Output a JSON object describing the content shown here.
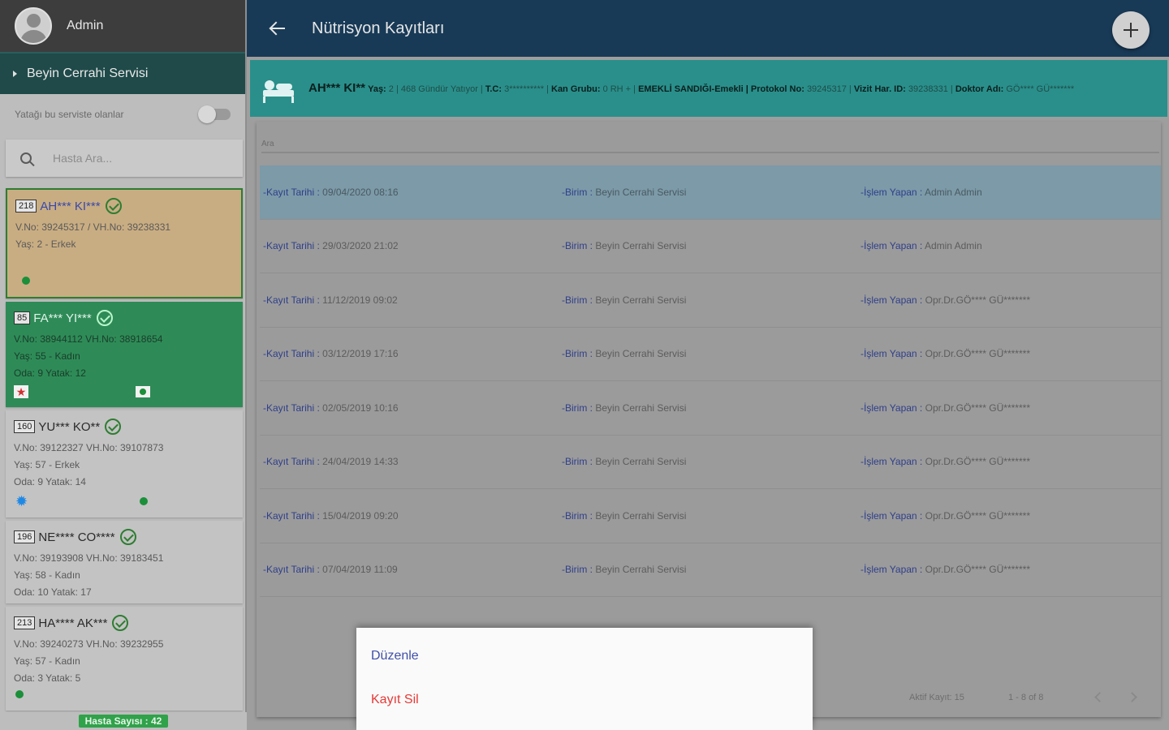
{
  "sidebar": {
    "user_name": "Admin",
    "service_name": "Beyin Cerrahi Servisi",
    "toggle_label": "Yatağı bu serviste olanlar",
    "search_placeholder": "Hasta Ara...",
    "patient_count": "Hasta Sayısı : 42",
    "patients": [
      {
        "bed": "218",
        "name": "AH*** KI***",
        "line1": "V.No: 39245317 / VH.No: 39238331",
        "line2": "Yaş: 2 - Erkek",
        "line3": ""
      },
      {
        "bed": "85",
        "name": "FA*** YI***",
        "line1": "V.No: 38944112 VH.No: 38918654",
        "line2": "Yaş: 55 - Kadın",
        "line3": "Oda: 9 Yatak: 12"
      },
      {
        "bed": "160",
        "name": "YU*** KO**",
        "line1": "V.No: 39122327 VH.No: 39107873",
        "line2": "Yaş: 57 - Erkek",
        "line3": "Oda: 9 Yatak: 14"
      },
      {
        "bed": "196",
        "name": "NE**** CO****",
        "line1": "V.No: 39193908 VH.No: 39183451",
        "line2": "Yaş: 58 - Kadın",
        "line3": "Oda: 10 Yatak: 17"
      },
      {
        "bed": "213",
        "name": "HA**** AK***",
        "line1": "V.No: 39240273 VH.No: 39232955",
        "line2": "Yaş: 57 - Kadın",
        "line3": "Oda: 3 Yatak: 5"
      }
    ]
  },
  "header": {
    "title": "Nütrisyon Kayıtları"
  },
  "banner": {
    "name": "AH*** KI**",
    "age_label": "Yaş:",
    "age_value": "2 | 468 Gündür Yatıyor |",
    "tc_label": "T.C:",
    "tc_value": "3********** |",
    "blood_label": "Kan Grubu:",
    "blood_value": "0 RH + |",
    "insurance": "EMEKLİ SANDIĞI-Emekli |",
    "protocol_label": "Protokol No:",
    "protocol_value": "39245317 |",
    "visit_label": "Vizit Har. ID:",
    "visit_value": "39238331 |",
    "doctor_label": "Doktor Adı:",
    "doctor_value": "GÖ**** GÜ*******"
  },
  "content": {
    "filter_label": "Ara",
    "labels": {
      "date": "-Kayıt Tarihi :",
      "unit": "-Birim :",
      "by": "-İşlem Yapan :"
    },
    "records": [
      {
        "date": "09/04/2020 08:16",
        "unit": "Beyin Cerrahi Servisi",
        "by": "Admin Admin"
      },
      {
        "date": "29/03/2020 21:02",
        "unit": "Beyin Cerrahi Servisi",
        "by": "Admin Admin"
      },
      {
        "date": "11/12/2019 09:02",
        "unit": "Beyin Cerrahi Servisi",
        "by": "Opr.Dr.GÖ**** GÜ*******"
      },
      {
        "date": "03/12/2019 17:16",
        "unit": "Beyin Cerrahi Servisi",
        "by": "Opr.Dr.GÖ**** GÜ*******"
      },
      {
        "date": "02/05/2019 10:16",
        "unit": "Beyin Cerrahi Servisi",
        "by": "Opr.Dr.GÖ**** GÜ*******"
      },
      {
        "date": "24/04/2019 14:33",
        "unit": "Beyin Cerrahi Servisi",
        "by": "Opr.Dr.GÖ**** GÜ*******"
      },
      {
        "date": "15/04/2019 09:20",
        "unit": "Beyin Cerrahi Servisi",
        "by": "Opr.Dr.GÖ**** GÜ*******"
      },
      {
        "date": "07/04/2019 11:09",
        "unit": "Beyin Cerrahi Servisi",
        "by": "Opr.Dr.GÖ**** GÜ*******"
      }
    ],
    "active_count": "Aktif Kayıt: 15",
    "page_range": "1 - 8 of 8"
  },
  "context_menu": {
    "edit": "Düzenle",
    "delete": "Kayıt Sil"
  }
}
